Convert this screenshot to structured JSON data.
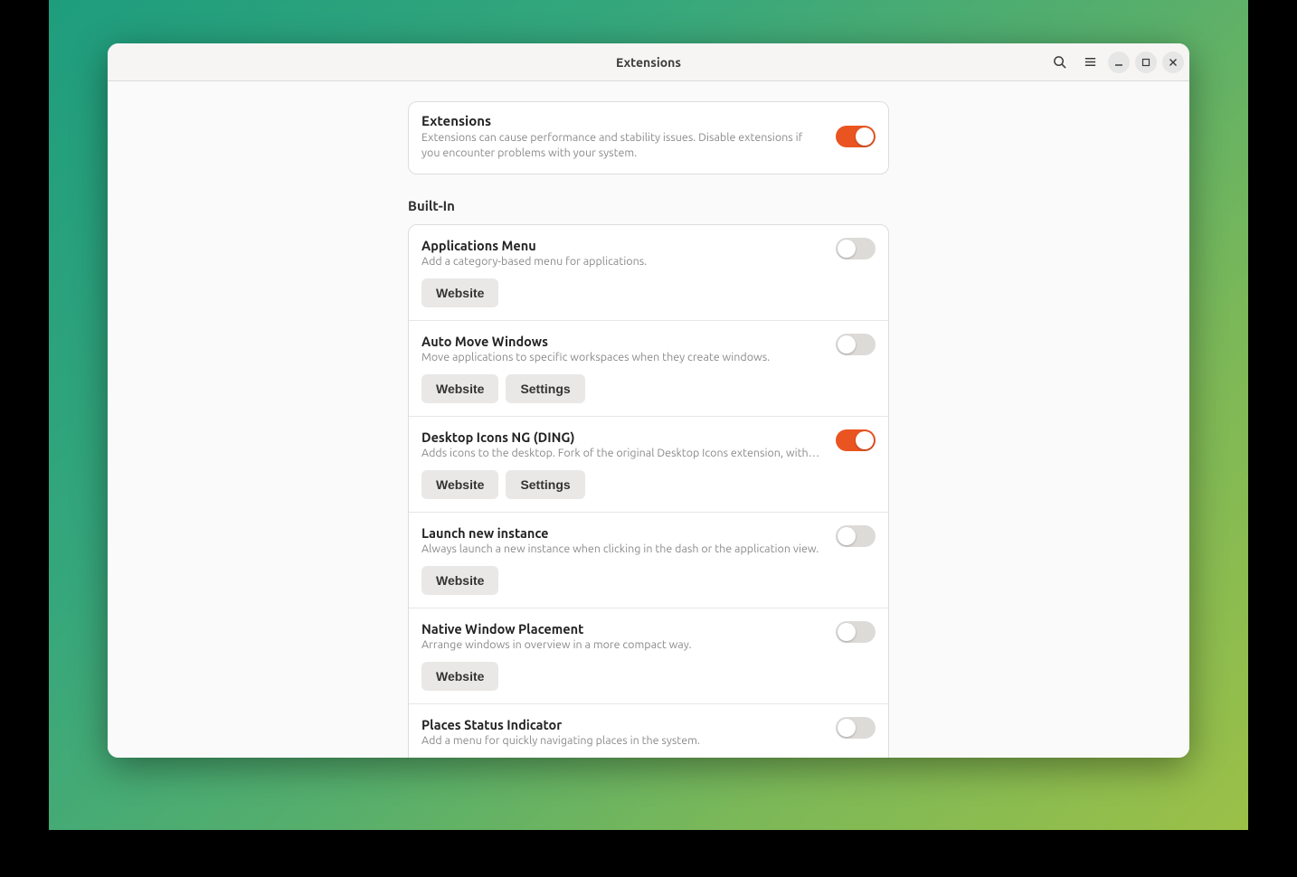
{
  "window": {
    "title": "Extensions"
  },
  "colors": {
    "accent": "#e95420"
  },
  "master": {
    "title": "Extensions",
    "description": "Extensions can cause performance and stability issues. Disable extensions if you encounter problems with your system.",
    "enabled": true
  },
  "section_label": "Built-In",
  "labels": {
    "website": "Website",
    "settings": "Settings"
  },
  "extensions": [
    {
      "name": "Applications Menu",
      "description": "Add a category-based menu for applications.",
      "enabled": false,
      "has_settings": false
    },
    {
      "name": "Auto Move Windows",
      "description": "Move applications to specific workspaces when they create windows.",
      "enabled": false,
      "has_settings": true
    },
    {
      "name": "Desktop Icons NG (DING)",
      "description": "Adds icons to the desktop. Fork of the original Desktop Icons extension, with several enh…",
      "enabled": true,
      "has_settings": true
    },
    {
      "name": "Launch new instance",
      "description": "Always launch a new instance when clicking in the dash or the application view.",
      "enabled": false,
      "has_settings": false
    },
    {
      "name": "Native Window Placement",
      "description": "Arrange windows in overview in a more compact way.",
      "enabled": false,
      "has_settings": false
    },
    {
      "name": "Places Status Indicator",
      "description": "Add a menu for quickly navigating places in the system.",
      "enabled": false,
      "has_settings": false
    }
  ]
}
